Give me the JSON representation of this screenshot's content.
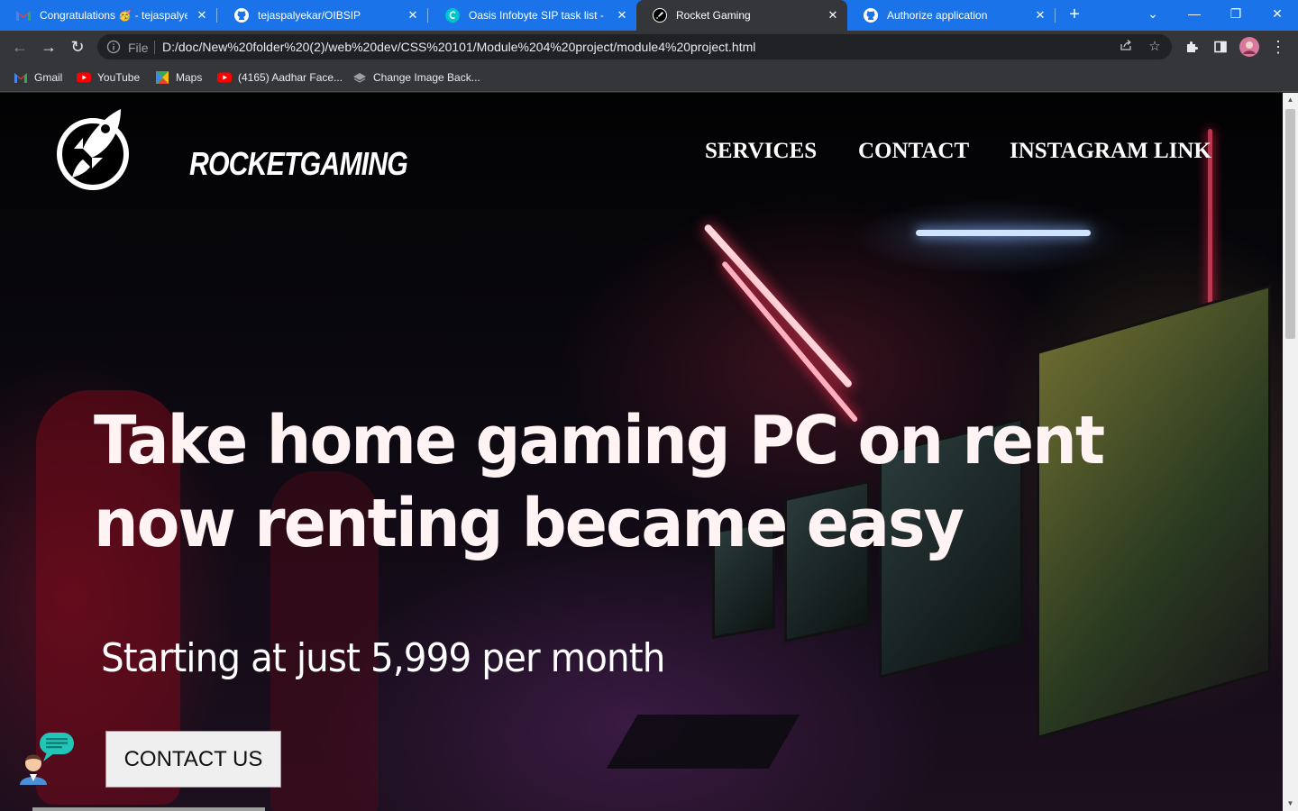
{
  "browser": {
    "tabs": [
      {
        "title": "Congratulations 🥳 - tejaspalyekar",
        "icon": "gmail-icon",
        "active": false
      },
      {
        "title": "tejaspalyekar/OIBSIP",
        "icon": "github-icon",
        "active": false
      },
      {
        "title": "Oasis Infobyte SIP task list - Preview",
        "icon": "canva-icon",
        "active": false
      },
      {
        "title": "Rocket Gaming",
        "icon": "rocket-icon",
        "active": true
      },
      {
        "title": "Authorize application",
        "icon": "github-icon",
        "active": false
      }
    ],
    "close_glyph": "✕",
    "new_tab_glyph": "+",
    "window_controls": {
      "dropdown": "⌄",
      "minimize": "—",
      "restore": "❐",
      "close": "✕"
    },
    "toolbar": {
      "back": "←",
      "forward": "→",
      "reload": "↻"
    },
    "omnibox": {
      "scheme_label": "File",
      "url": "D:/doc/New%20folder%20(2)/web%20dev/CSS%20101/Module%204%20project/module4%20project.html"
    },
    "bookmarks": [
      {
        "label": "Gmail",
        "icon": "gmail-icon"
      },
      {
        "label": "YouTube",
        "icon": "youtube-icon"
      },
      {
        "label": "Maps",
        "icon": "maps-icon"
      },
      {
        "label": "(4165) Aadhar Face...",
        "icon": "youtube-icon"
      },
      {
        "label": "Change Image Back...",
        "icon": "layers-icon"
      }
    ]
  },
  "page": {
    "logo_text": "ROCKETGAMING",
    "nav": [
      "SERVICES",
      "CONTACT",
      "INSTAGRAM LINK"
    ],
    "headline_line1": "Take home gaming PC on rent",
    "headline_line2": "now renting became easy",
    "subline": "Starting at just 5,999 per month",
    "cta_label": "CONTACT US"
  },
  "colors": {
    "tabstrip": "#1a73e8",
    "toolbar": "#35363a",
    "page_text": "#ffffff",
    "cta_bg": "#efefef",
    "chat_bubble": "#21c6b8"
  }
}
